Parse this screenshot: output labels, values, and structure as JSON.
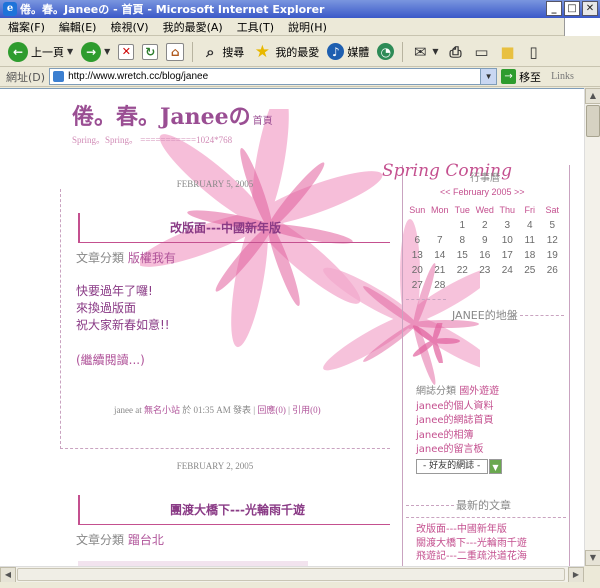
{
  "window": {
    "title": "倦。春。Janeeの - 首頁 - Microsoft Internet Explorer"
  },
  "menu": [
    "檔案(F)",
    "編輯(E)",
    "檢視(V)",
    "我的最愛(A)",
    "工具(T)",
    "說明(H)"
  ],
  "toolbar": {
    "back": "上一頁",
    "search": "搜尋",
    "favorites": "我的最愛",
    "media": "媒體"
  },
  "address": {
    "label": "網址(D)",
    "url": "http://www.wretch.cc/blog/janee",
    "go": "移至",
    "links": "Links"
  },
  "blog": {
    "title": "倦。春。Janeeの",
    "home_link": "首頁",
    "subtitle": "Spring。Spring。 ===========1024*768"
  },
  "posts": [
    {
      "date": "FEBRUARY 5, 2005",
      "title": "改版面---中國新年版",
      "category_label": "文章分類",
      "category": "版權我有",
      "lines": [
        "快要過年了囉!",
        "來換過版面",
        "祝大家新春如意!!"
      ],
      "read_more": "(繼續閱讀...)",
      "footer": {
        "author": "janee",
        "at": "at",
        "site": "無名小站",
        "time": "於 01:35 AM 發表",
        "sep1": "|",
        "comments": "回應(0)",
        "sep2": "|",
        "trackback": "引用(0)"
      }
    },
    {
      "date": "FEBRUARY 2, 2005",
      "title": "團渡大橋下---光輪雨千遊",
      "category_label": "文章分類",
      "category": "蹓台北"
    }
  ],
  "sidebar": {
    "spring_text": "Spring Coming",
    "calendar_title": "行事曆",
    "calendar_month": "<< February 2005 >>",
    "weekdays": [
      "Sun",
      "Mon",
      "Tue",
      "Wed",
      "Thu",
      "Fri",
      "Sat"
    ],
    "weeks": [
      [
        "",
        "",
        "1",
        "2",
        "3",
        "4",
        "5"
      ],
      [
        "6",
        "7",
        "8",
        "9",
        "10",
        "11",
        "12"
      ],
      [
        "13",
        "14",
        "15",
        "16",
        "17",
        "18",
        "19"
      ],
      [
        "20",
        "21",
        "22",
        "23",
        "24",
        "25",
        "26"
      ],
      [
        "27",
        "28",
        "",
        "",
        "",
        "",
        ""
      ]
    ],
    "turf_title": "JANEE的地盤",
    "links": [
      {
        "label": "網誌分類",
        "value": "國外遊遊"
      },
      {
        "value": "janee的個人資料"
      },
      {
        "value": "janee的網誌首頁"
      },
      {
        "value": "janee的相簿"
      },
      {
        "value": "janee的留言板"
      }
    ],
    "friends_select": "- 好友的網誌 -",
    "recent_title": "最新的文章",
    "recent": [
      "改版面---中國新年版",
      "關渡大橋下---光輪雨千遊",
      "飛遊記---二重疏洪道花海"
    ]
  },
  "colors": {
    "accent": "#C4508F",
    "title": "#9A4E93",
    "xp_blue": "#3A58C8"
  }
}
